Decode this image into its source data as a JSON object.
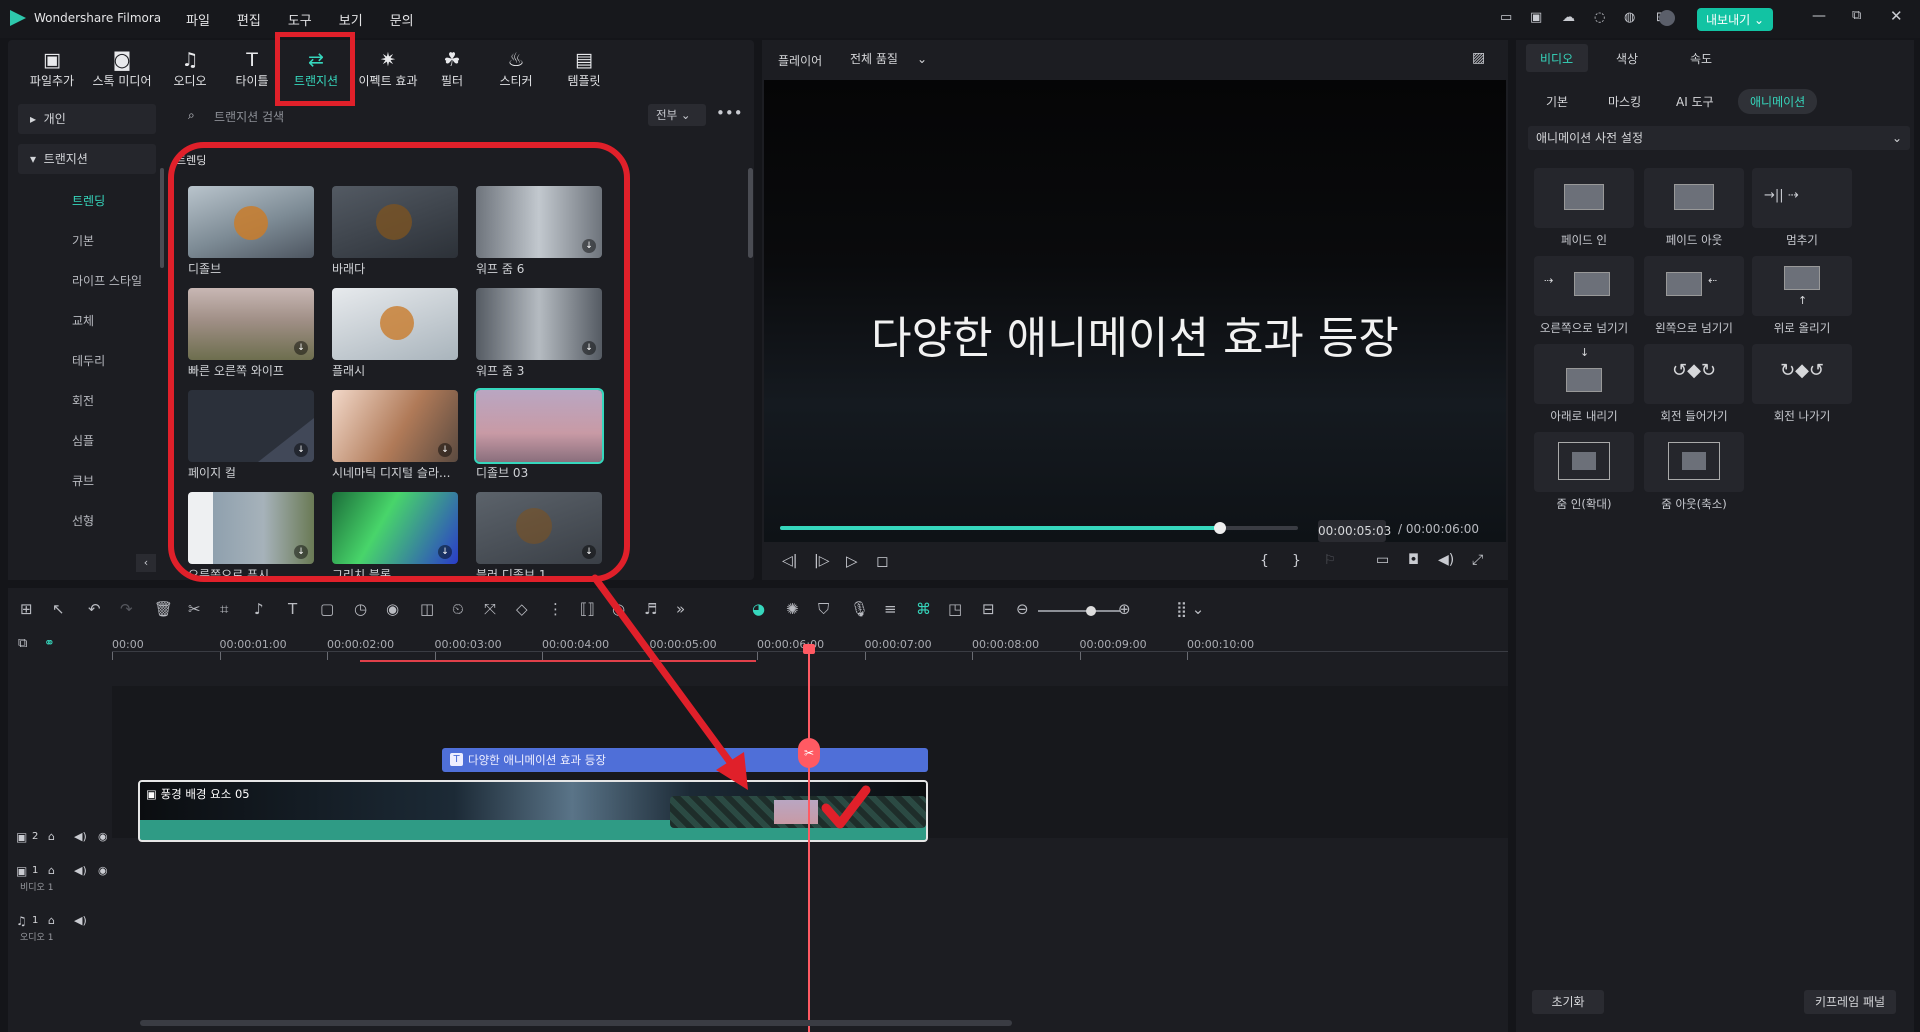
{
  "app": {
    "title": "Wondershare Filmora"
  },
  "menu": [
    "파일",
    "편집",
    "도구",
    "보기",
    "문의"
  ],
  "export_label": "내보내기",
  "media_tabs": [
    {
      "label": "파일추가",
      "icon": "import-media-icon"
    },
    {
      "label": "스톡 미디어",
      "icon": "stock-media-icon"
    },
    {
      "label": "오디오",
      "icon": "music-note-icon"
    },
    {
      "label": "타이틀",
      "icon": "title-T-icon"
    },
    {
      "label": "트랜지션",
      "icon": "transition-icon"
    },
    {
      "label": "이펙트 효과",
      "icon": "effects-icon"
    },
    {
      "label": "필터",
      "icon": "filter-icon"
    },
    {
      "label": "스티커",
      "icon": "sticker-icon"
    },
    {
      "label": "템플릿",
      "icon": "template-icon"
    }
  ],
  "sidebar": {
    "personal": "개인",
    "transitions": "트랜지션",
    "items": [
      "트렌딩",
      "기본",
      "라이프 스타일",
      "교체",
      "테두리",
      "회전",
      "심플",
      "큐브",
      "선형"
    ]
  },
  "search": {
    "placeholder": "트랜지션 검색",
    "filter": "전부"
  },
  "section_title": "트렌딩",
  "transitions": [
    "디졸브",
    "바래다",
    "워프 줌 6",
    "빠른 오른쪽 와이프",
    "플래시",
    "워프 줌 3",
    "페이지 컬",
    "시네마틱 디지털 슬라...",
    "디졸브 03",
    "오른쪽으로 푸시",
    "그리치 블록",
    "블러 디졸브 1"
  ],
  "player": {
    "label": "플레이어",
    "quality": "전체 품질",
    "overlay_text": "다양한 애니메이션 효과 등장",
    "current_time": "00:00:05:03",
    "total_time": "/ 00:00:06:00",
    "progress": 0.85
  },
  "right_panel": {
    "tabs": [
      "비디오",
      "색상",
      "속도"
    ],
    "subtabs": [
      "기본",
      "마스킹",
      "AI 도구",
      "애니메이션"
    ],
    "preset_dropdown": "애니메이션 사전 설정",
    "presets": [
      "페이드 인",
      "페이드 아웃",
      "멈추기",
      "오른쪽으로 넘기기",
      "왼쪽으로 넘기기",
      "위로 올리기",
      "아래로 내리기",
      "회전 들어가기",
      "회전 나가기",
      "줌 인(확대)",
      "줌 아웃(축소)"
    ],
    "reset": "초기화",
    "keyframe": "키프레임 패널"
  },
  "timeline": {
    "ticks": [
      "00:00",
      "00:00:01:00",
      "00:00:02:00",
      "00:00:03:00",
      "00:00:04:00",
      "00:00:05:00",
      "00:00:06:00",
      "00:00:07:00",
      "00:00:08:00",
      "00:00:09:00",
      "00:00:10:00"
    ],
    "title_clip": "다양한 애니메이션 효과 등장",
    "video_clip": "풍경 배경 요소 05",
    "track_video2": "2",
    "track_video1": "1",
    "track_video1_name": "비디오 1",
    "track_audio1": "1",
    "track_audio1_name": "오디오 1"
  },
  "colors": {
    "accent": "#36d7bd",
    "annotation": "#e0202a",
    "title_clip": "#4f6fd8",
    "video_clip": "#2f9b85"
  }
}
